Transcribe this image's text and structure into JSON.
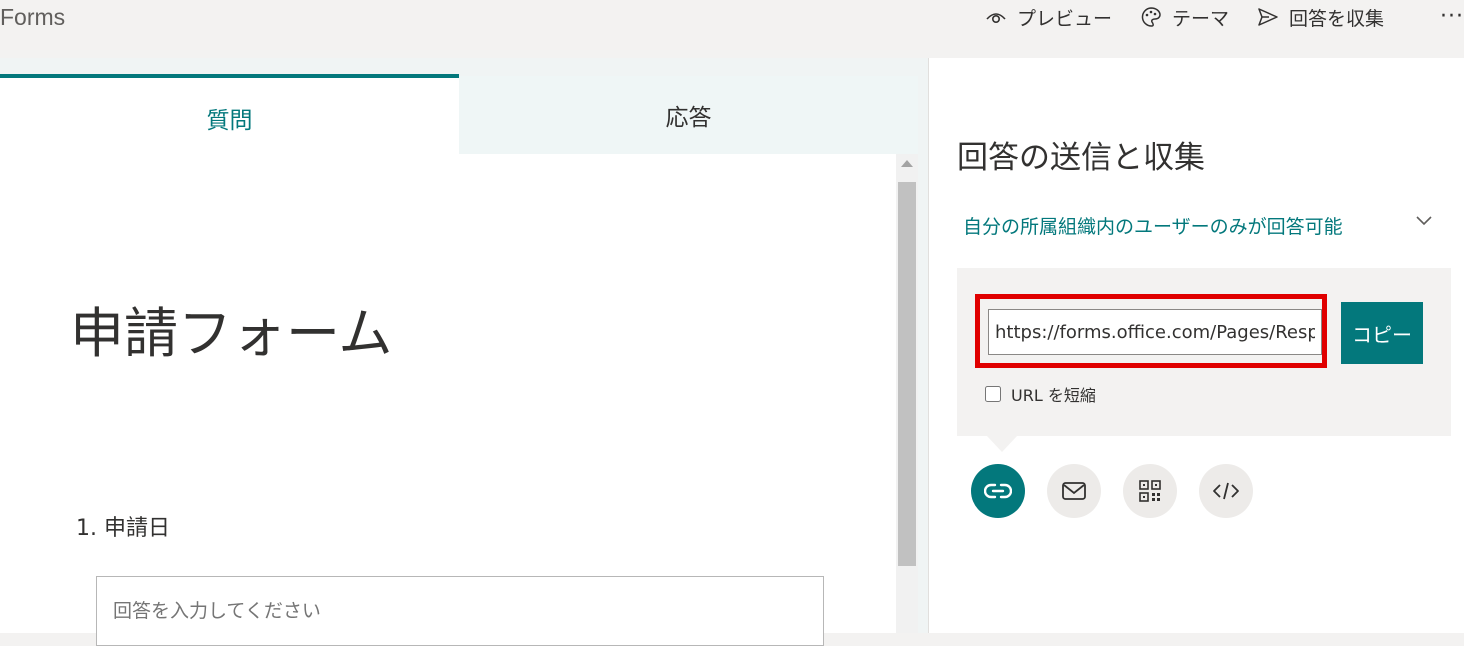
{
  "header": {
    "app_title": "Forms",
    "actions": [
      {
        "label": "プレビュー",
        "icon": "eye-icon"
      },
      {
        "label": "テーマ",
        "icon": "palette-icon"
      },
      {
        "label": "回答を収集",
        "icon": "send-icon"
      }
    ],
    "more": "···"
  },
  "tabs": [
    {
      "label": "質問",
      "selected": true
    },
    {
      "label": "応答",
      "selected": false
    }
  ],
  "form": {
    "title": "申請フォーム",
    "question_label": "1. 申請日",
    "answer_placeholder": "回答を入力してください"
  },
  "share_panel": {
    "title": "回答の送信と収集",
    "permission": "自分の所属組織内のユーザーのみが回答可能",
    "url": "https://forms.office.com/Pages/Respon",
    "copy_label": "コピー",
    "shorten_label": "URL を短縮",
    "share_methods": [
      "link-icon",
      "mail-icon",
      "qr-code-icon",
      "embed-code-icon"
    ]
  },
  "colors": {
    "accent": "#03787c",
    "highlight": "#e00000"
  }
}
